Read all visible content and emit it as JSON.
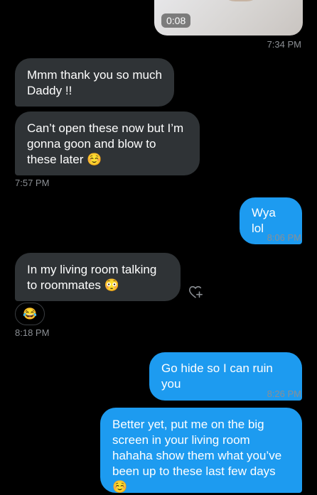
{
  "video": {
    "duration": "0:08"
  },
  "messages": [
    {
      "type": "time",
      "text": "7:34 PM"
    },
    {
      "type": "in",
      "text": "Mmm thank you so much Daddy !!"
    },
    {
      "type": "in",
      "text": "Can’t open these now but I’m gonna goon and blow to these later ☺️"
    },
    {
      "type": "time",
      "text": "7:57 PM"
    },
    {
      "type": "out",
      "text": "Wya lol"
    },
    {
      "type": "time",
      "text": "8:06 PM"
    },
    {
      "type": "in",
      "text": "In my living room talking to roommates 😳"
    },
    {
      "type": "reaction",
      "text": "😂"
    },
    {
      "type": "time",
      "text": "8:18 PM"
    },
    {
      "type": "out",
      "text": "Go hide so I can ruin you"
    },
    {
      "type": "time",
      "text": "8:26 PM"
    },
    {
      "type": "out",
      "text": "Better yet, put me on the big screen in your living room hahaha show them what you’ve been up to these last few days ☺️"
    }
  ],
  "icons": {
    "react": "heart-plus-icon"
  },
  "colors": {
    "incoming": "#2f3336",
    "outgoing": "#1d9bf0",
    "timestamp": "#8b8f94"
  }
}
